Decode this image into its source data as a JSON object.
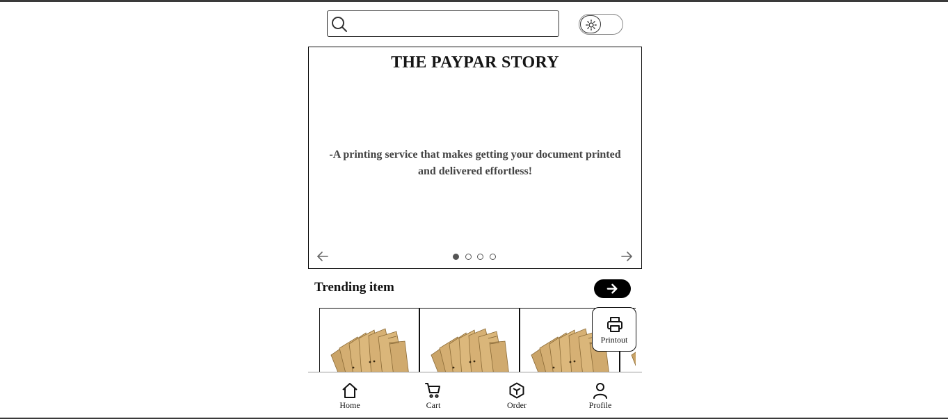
{
  "search": {
    "placeholder": "",
    "value": ""
  },
  "theme_toggle": {
    "state": "light",
    "icon": "sun-icon"
  },
  "carousel": {
    "title": "THE PAYPAR STORY",
    "text": "-A printing service that makes getting your document printed and delivered effortless!",
    "slide_count": 4,
    "active_slide": 1
  },
  "trending": {
    "title": "Trending item",
    "arrow_icon": "arrow-right-icon",
    "items": [
      {
        "image": "document-stack-image"
      },
      {
        "image": "document-stack-image"
      },
      {
        "image": "document-stack-image"
      },
      {
        "image": "document-stack-image"
      }
    ]
  },
  "floating_button": {
    "label": "Printout",
    "icon": "printer-icon"
  },
  "bottom_nav": {
    "items": [
      {
        "label": "Home",
        "icon": "home-icon"
      },
      {
        "label": "Cart",
        "icon": "cart-icon"
      },
      {
        "label": "Order",
        "icon": "box-icon"
      },
      {
        "label": "Profile",
        "icon": "user-icon"
      }
    ]
  },
  "colors": {
    "accent": "#000000",
    "text": "#111111",
    "muted_text": "#444444",
    "background": "#ffffff"
  }
}
